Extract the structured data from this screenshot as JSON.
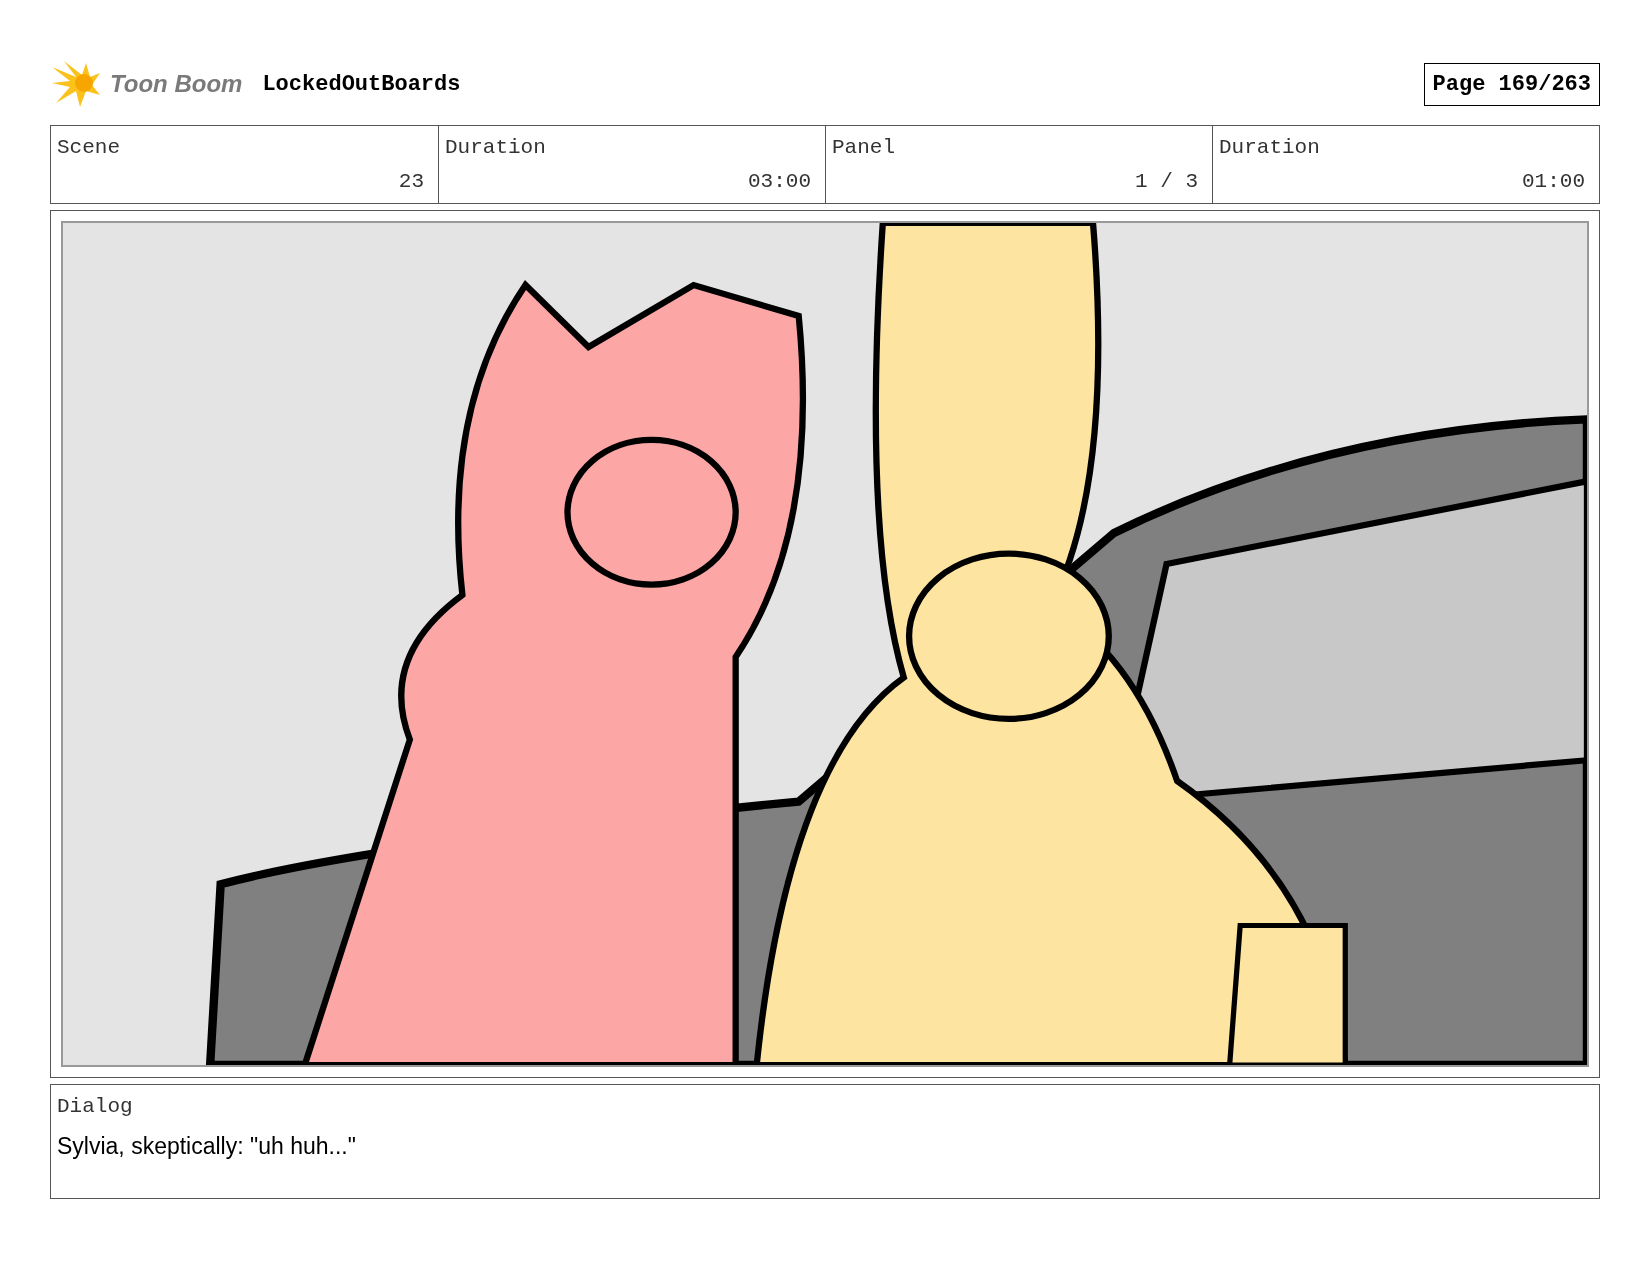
{
  "header": {
    "logo_text": "Toon Boom",
    "project": "LockedOutBoards",
    "page": "Page 169/263"
  },
  "info": [
    {
      "label": "Scene",
      "value": "23"
    },
    {
      "label": "Duration",
      "value": "03:00"
    },
    {
      "label": "Panel",
      "value": "1 / 3"
    },
    {
      "label": "Duration",
      "value": "01:00"
    }
  ],
  "dialog": {
    "label": "Dialog",
    "text": "Sylvia, skeptically: \"uh huh...\""
  }
}
